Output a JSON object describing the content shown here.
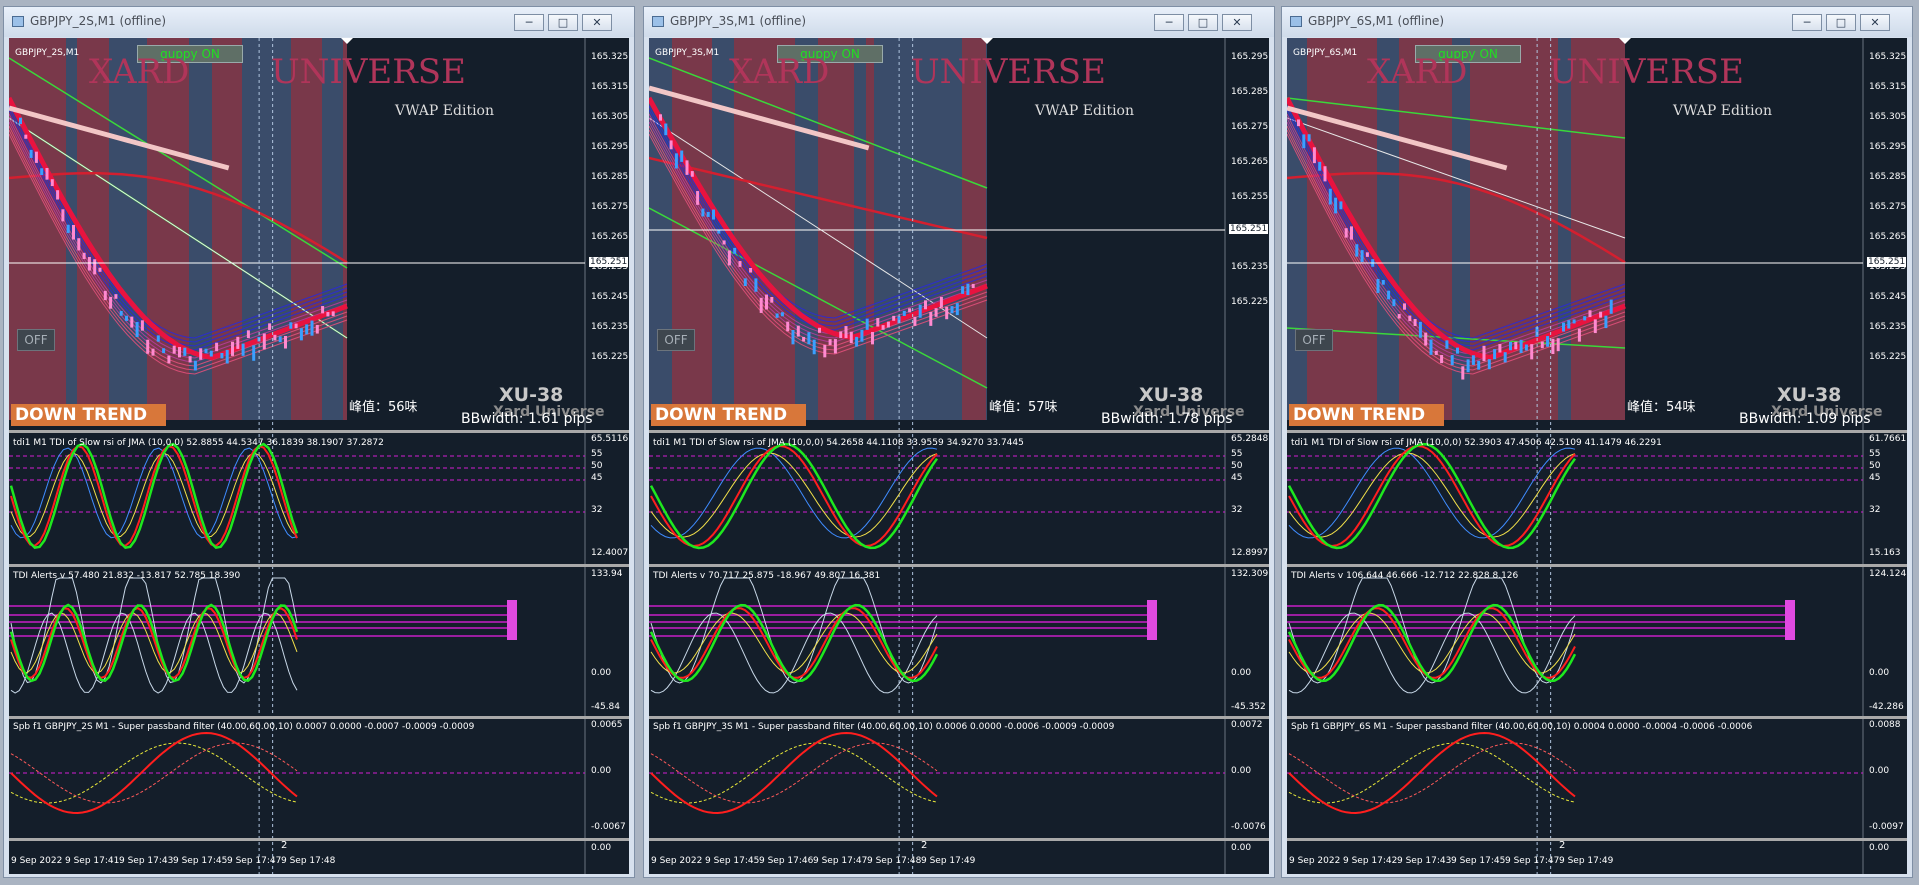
{
  "windows": [
    {
      "title": "GBPJPY_2S,M1 (offline)",
      "symbol": "GBPJPY_2S,M1",
      "guppy": "guppy ON",
      "brand1": "XARD",
      "brand2": "UNIVERSE",
      "edition": "VWAP Edition",
      "off": "OFF",
      "trend": "DOWN TREND",
      "xu": "XU-38",
      "xu_sub": "Xard Universe",
      "fengjia": "峰值：56味",
      "bbwidth": "BBwidth: 1.61 pips",
      "price_axis": [
        "165.325",
        "165.315",
        "165.305",
        "165.295",
        "165.285",
        "165.275",
        "165.265",
        "165.255",
        "165.245",
        "165.235",
        "165.225"
      ],
      "current_price": "165.251",
      "tdi_label": "tdi1 M1 TDI of Slow rsi of JMA (10,0,0) 52.8855 44.5347 36.1839 38.1907 37.2872",
      "tdi_axis_top": "65.5116",
      "tdi_levels": [
        "55",
        "50",
        "45",
        "32"
      ],
      "tdi_axis_bottom": "12.4007",
      "alerts_label": "TDI Alerts v 57.480 21.832 -13.817 52.785 18.390",
      "alerts_axis_top": "133.94",
      "alerts_axis_zero": "0.00",
      "alerts_axis_bottom": "-45.84",
      "spb_label": "Spb f1 GBPJPY_2S M1 - Super passband filter (40.00,60.00,10) 0.0007 0.0000 -0.0007 -0.0009 -0.0009",
      "spb_axis_top": "0.0065",
      "spb_axis_zero": "0.00",
      "spb_axis_bottom": "-0.0067",
      "scroll_num": "2",
      "scroll_axis": "0.00",
      "time_axis": [
        "9 Sep 2022",
        "9 Sep 17:41",
        "9 Sep 17:43",
        "9 Sep 17:45",
        "9 Sep 17:47",
        "9 Sep 17:48"
      ]
    },
    {
      "title": "GBPJPY_3S,M1 (offline)",
      "symbol": "GBPJPY_3S,M1",
      "guppy": "guppy ON",
      "brand1": "XARD",
      "brand2": "UNIVERSE",
      "edition": "VWAP Edition",
      "off": "OFF",
      "trend": "DOWN TREND",
      "xu": "XU-38",
      "xu_sub": "Xard Universe",
      "fengjia": "峰值：57味",
      "bbwidth": "BBwidth: 1.78 pips",
      "price_axis": [
        "165.295",
        "165.285",
        "165.275",
        "165.265",
        "165.255",
        "165.245",
        "165.235",
        "165.225"
      ],
      "current_price": "165.251",
      "tdi_label": "tdi1 M1 TDI of Slow rsi of JMA (10,0,0) 54.2658 44.1108 33.9559 34.9270 33.7445",
      "tdi_axis_top": "65.2848",
      "tdi_levels": [
        "55",
        "50",
        "45",
        "32"
      ],
      "tdi_axis_bottom": "12.8997",
      "alerts_label": "TDI Alerts v 70.717 25.875 -18.967 49.807 16.381",
      "alerts_axis_top": "132.309",
      "alerts_axis_zero": "0.00",
      "alerts_axis_bottom": "-45.352",
      "spb_label": "Spb f1 GBPJPY_3S M1 - Super passband filter (40.00,60.00,10) 0.0006 0.0000 -0.0006 -0.0009 -0.0009",
      "spb_axis_top": "0.0072",
      "spb_axis_zero": "0.00",
      "spb_axis_bottom": "-0.0076",
      "scroll_num": "2",
      "scroll_axis": "0.00",
      "time_axis": [
        "9 Sep 2022",
        "9 Sep 17:45",
        "9 Sep 17:46",
        "9 Sep 17:47",
        "9 Sep 17:48",
        "9 Sep 17:49"
      ]
    },
    {
      "title": "GBPJPY_6S,M1 (offline)",
      "symbol": "GBPJPY_6S,M1",
      "guppy": "guppy ON",
      "brand1": "XARD",
      "brand2": "UNIVERSE",
      "edition": "VWAP Edition",
      "off": "OFF",
      "trend": "DOWN TREND",
      "xu": "XU-38",
      "xu_sub": "Xard Universe",
      "fengjia": "峰值：54味",
      "bbwidth": "BBwidth: 1.09 pips",
      "price_axis": [
        "165.325",
        "165.315",
        "165.305",
        "165.295",
        "165.285",
        "165.275",
        "165.265",
        "165.255",
        "165.245",
        "165.235",
        "165.225"
      ],
      "current_price": "165.251",
      "tdi_label": "tdi1 M1 TDI of Slow rsi of JMA (10,0,0) 52.3903 47.4506 42.5109 41.1479 46.2291",
      "tdi_axis_top": "61.7661",
      "tdi_levels": [
        "55",
        "50",
        "45",
        "32"
      ],
      "tdi_axis_bottom": "15.163",
      "alerts_label": "TDI Alerts v 106.644 46.666 -12.712 22.828 8.126",
      "alerts_axis_top": "124.124",
      "alerts_axis_zero": "0.00",
      "alerts_axis_bottom": "-42.286",
      "spb_label": "Spb f1 GBPJPY_6S M1 - Super passband filter (40.00,60.00,10) 0.0004 0.0000 -0.0004 -0.0006 -0.0006",
      "spb_axis_top": "0.0088",
      "spb_axis_zero": "0.00",
      "spb_axis_bottom": "-0.0097",
      "scroll_num": "2",
      "scroll_axis": "0.00",
      "time_axis": [
        "9 Sep 2022",
        "9 Sep 17:42",
        "9 Sep 17:43",
        "9 Sep 17:45",
        "9 Sep 17:47",
        "9 Sep 17:49"
      ]
    }
  ],
  "colors": {
    "background": "#141e2a",
    "band_red": "#7e3a4c",
    "band_blue": "#3c4f6e",
    "bull_line": "#0a2cff",
    "bear_line": "#e8133f",
    "tdi_green": "#1ee81e",
    "tdi_red": "#ff1e1e",
    "level_magenta": "#d21fd2"
  }
}
